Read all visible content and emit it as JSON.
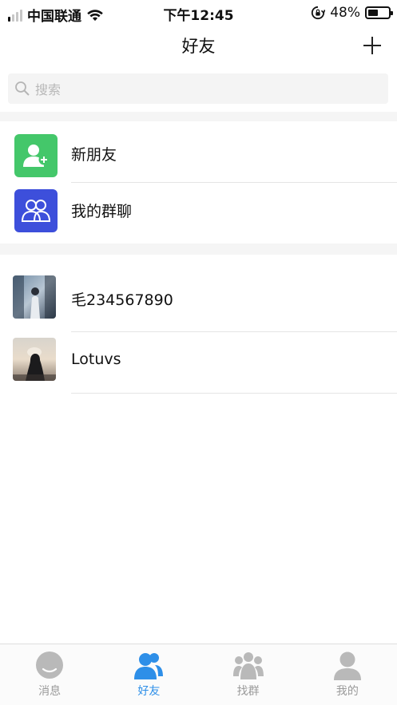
{
  "status_bar": {
    "carrier": "中国联通",
    "time": "下午12:45",
    "battery_percent": "48%",
    "battery_level": 0.48
  },
  "nav": {
    "title": "好友"
  },
  "search": {
    "placeholder": "搜索"
  },
  "shortcuts": [
    {
      "label": "新朋友",
      "icon": "add-friend-icon",
      "color": "#44c76a"
    },
    {
      "label": "我的群聊",
      "icon": "group-chat-icon",
      "color": "#3d4fdb"
    }
  ],
  "friends": [
    {
      "name": "毛234567890",
      "avatar": "avatar-photo"
    },
    {
      "name": "Lotuvs",
      "avatar": "avatar-photo"
    }
  ],
  "tabs": [
    {
      "label": "消息",
      "icon": "message-icon",
      "active": false
    },
    {
      "label": "好友",
      "icon": "friends-icon",
      "active": true
    },
    {
      "label": "找群",
      "icon": "find-group-icon",
      "active": false
    },
    {
      "label": "我的",
      "icon": "profile-icon",
      "active": false
    }
  ],
  "colors": {
    "accent": "#2e8fe8",
    "inactive_tab": "#9a9a9a"
  }
}
